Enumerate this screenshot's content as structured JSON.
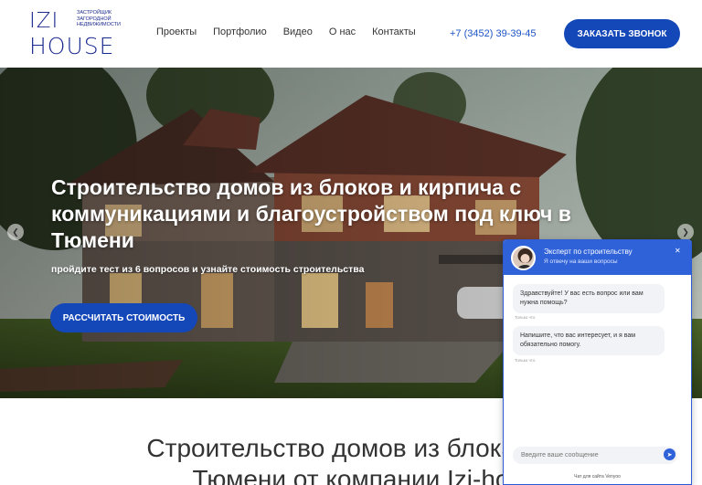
{
  "header": {
    "logo_top": "IZI",
    "logo_bottom": "HOUSE",
    "logo_tagline": "ЗАСТРОЙЩИК ЗАГОРОДНОЙ НЕДВИЖИМОСТИ",
    "nav": [
      "Проекты",
      "Портфолио",
      "Видео",
      "О нас",
      "Контакты"
    ],
    "phone": "+7 (3452) 39-39-45",
    "cta": "ЗАКАЗАТЬ ЗВОНОК"
  },
  "hero": {
    "title": "Строительство домов из блоков и кирпича с коммуникациями и благоустройством под ключ в Тюмени",
    "subtitle": "пройдите тест из 6 вопросов и узнайте стоимость строительства",
    "button": "РАССЧИТАТЬ СТОИМОСТЬ",
    "prev_icon": "chevron-left-icon",
    "next_icon": "chevron-right-icon"
  },
  "section": {
    "title_line1": "Строительство домов из блока и к",
    "title_line2": "Тюмени от компании Izi-ho"
  },
  "chat": {
    "agent_name": "Эксперт по строительству",
    "agent_status": "Я отвечу на ваши вопросы",
    "messages": [
      {
        "text": "Здравствуйте! У вас есть вопрос или вам нужна помощь?",
        "time": "Только что"
      },
      {
        "text": "Напишите, что вас интересует, и я вам обязательно помогу.",
        "time": "Только что"
      }
    ],
    "input_placeholder": "Введите ваше сообщение",
    "footer": "Чат для сайта Venyoo"
  },
  "colors": {
    "brand_blue": "#1447b8",
    "chat_blue": "#2f62d9",
    "logo_navy": "#1b2a8f"
  }
}
